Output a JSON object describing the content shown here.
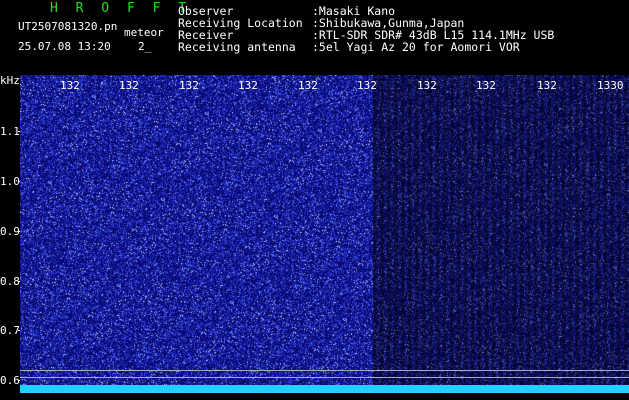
{
  "header": {
    "program": "H R O F F T",
    "file_name": "UT2507081320.pn",
    "mode": "meteor",
    "datetime": "25.07.08 13:20",
    "count": "2_",
    "info": [
      {
        "key": "Observer",
        "value": ":Masaki Kano"
      },
      {
        "key": "Receiving Location",
        "value": ":Shibukawa,Gunma,Japan"
      },
      {
        "key": "Receiver",
        "value": ":RTL-SDR SDR# 43dB L15 114.1MHz USB"
      },
      {
        "key": "Receiving antenna",
        "value": ":5el Yagi Az 20 for Aomori VOR"
      }
    ]
  },
  "y_axis": {
    "unit": "kHz",
    "labels": [
      "1.1",
      "1.0",
      "0.9",
      "0.8",
      "0.7",
      "0.6"
    ]
  },
  "x_axis": {
    "labels": [
      "132",
      "132",
      "132",
      "132",
      "132",
      "132",
      "132",
      "132",
      "132",
      "1330"
    ]
  },
  "colors": {
    "background": "#0a0a7a",
    "noise": "#4a5aff",
    "baseline": "#22d0ff",
    "title": "#1fe01f"
  }
}
